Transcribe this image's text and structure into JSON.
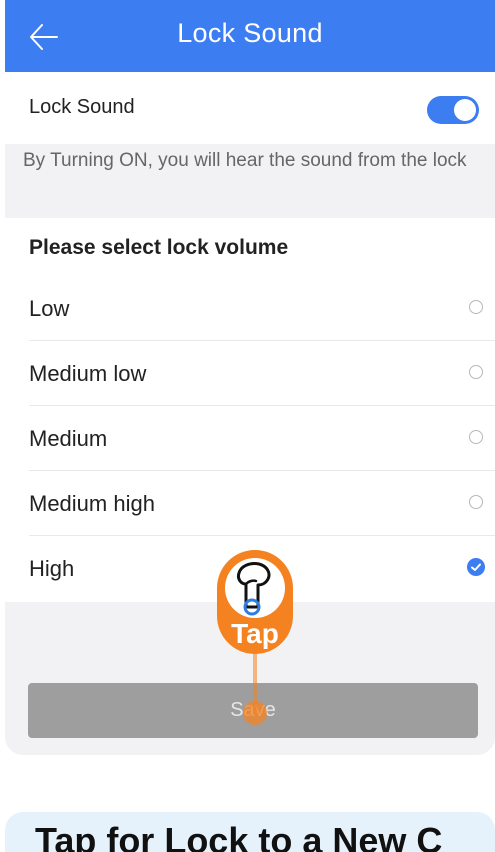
{
  "header": {
    "title": "Lock Sound",
    "back_icon": "arrow-left-icon"
  },
  "lock_sound": {
    "label": "Lock Sound",
    "enabled": true,
    "hint": "By Turning ON, you will hear the sound from the lock"
  },
  "volume": {
    "heading": "Please select lock volume",
    "options": [
      {
        "label": "Low",
        "selected": false
      },
      {
        "label": "Medium low",
        "selected": false
      },
      {
        "label": "Medium",
        "selected": false
      },
      {
        "label": "Medium high",
        "selected": false
      },
      {
        "label": "High",
        "selected": true
      }
    ]
  },
  "save_label": "Save",
  "tap_hint": {
    "label": "Tap",
    "icon": "pointing-hand-icon"
  },
  "promo": {
    "text": "Tap for Lock to a New C"
  },
  "colors": {
    "accent": "#3d7df2",
    "tap": "#f58220",
    "save_disabled": "#9e9e9e"
  }
}
